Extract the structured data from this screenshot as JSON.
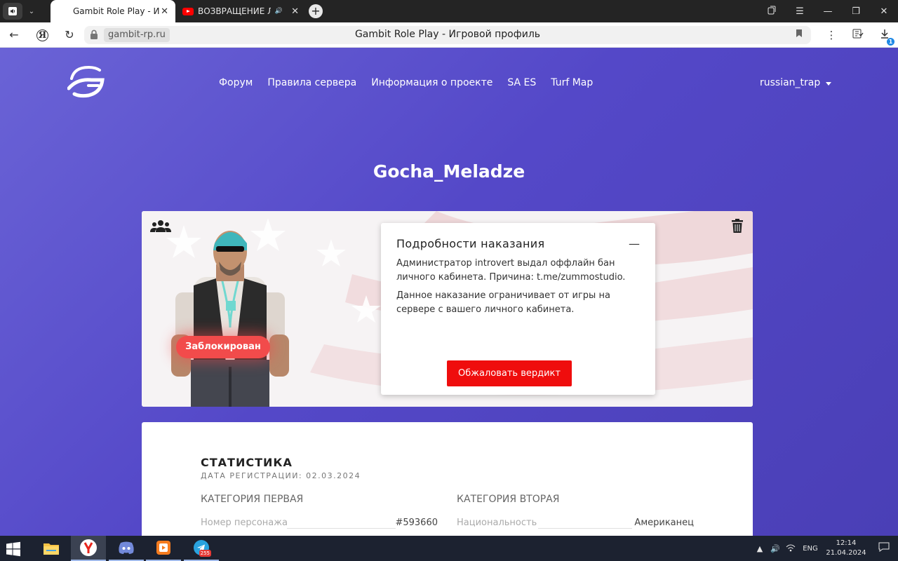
{
  "browser": {
    "tabs": [
      {
        "title": "Gambit Role Play - Игровой профиль",
        "close": "✕"
      },
      {
        "title": "ВОЗВРАЩЕНИЕ ЛЕГЕНДЫ",
        "close": "✕",
        "audio": "🔊"
      }
    ],
    "new_tab": "+",
    "window_controls": {
      "minimize": "—",
      "maximize": "❐",
      "close": "✕"
    },
    "address": {
      "domain": "gambit-rp.ru",
      "page_title": "Gambit Role Play - Игровой профиль"
    },
    "downloads_badge": "1"
  },
  "site": {
    "nav": [
      "Форум",
      "Правила сервера",
      "Информация о проекте",
      "SA ES",
      "Turf Map"
    ],
    "user": "russian_trap"
  },
  "profile": {
    "name": "Gocha_Meladze",
    "status_badge": "Заблокирован",
    "penalty": {
      "title": "Подробности наказания",
      "minimize": "—",
      "text1": "Администратор introvert выдал оффлайн бан личного кабинета. Причина: t.me/zummostudio.",
      "text2": "Данное наказание ограничивает от игры на сервере с вашего личного кабинета.",
      "appeal_button": "Обжаловать вердикт"
    }
  },
  "stats": {
    "title": "СТАТИСТИКА",
    "registered": "ДАТА РЕГИСТРАЦИИ: 02.03.2024",
    "category1": {
      "title": "КАТЕГОРИЯ ПЕРВАЯ",
      "rows": [
        {
          "label": "Номер персонажа",
          "value": "#593660"
        }
      ]
    },
    "category2": {
      "title": "КАТЕГОРИЯ ВТОРАЯ",
      "rows": [
        {
          "label": "Национальность",
          "value": "Американец"
        }
      ]
    }
  },
  "taskbar": {
    "telegram_badge": "255",
    "lang": "ENG",
    "time": "12:14",
    "date": "21.04.2024"
  },
  "colors": {
    "page_gradient_start": "#6a63d6",
    "page_gradient_end": "#4a3fb6",
    "blocked_badge": "#f24b4b",
    "appeal_button": "#ef0d0d"
  }
}
